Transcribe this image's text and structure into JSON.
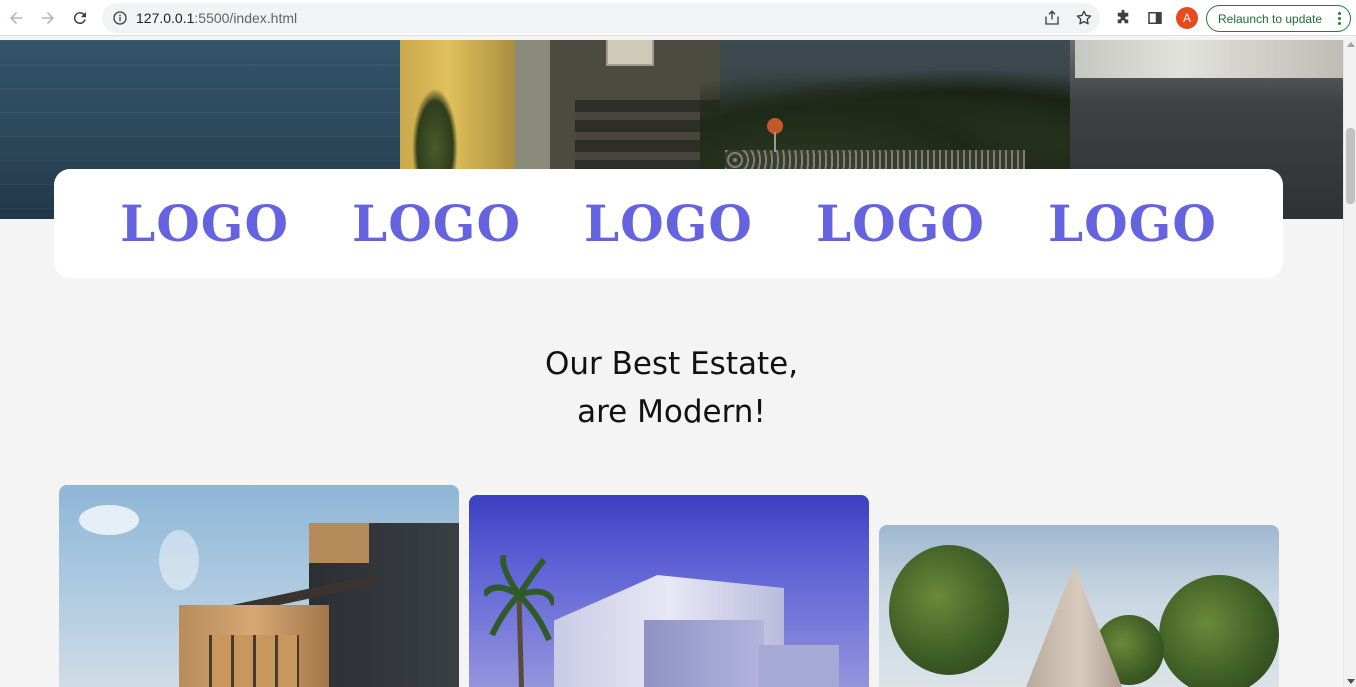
{
  "browser": {
    "url_host": "127.0.0.1",
    "url_rest": ":5500/index.html",
    "profile_initial": "A",
    "relaunch_label": "Relaunch to update",
    "accent": "#e8491d"
  },
  "logos": [
    "LOGO",
    "LOGO",
    "LOGO",
    "LOGO",
    "LOGO"
  ],
  "section": {
    "heading_line1": "Our Best Estate,",
    "heading_line2": "are Modern!"
  },
  "colors": {
    "logo": "#6563e0",
    "background": "#f4f4f4"
  }
}
